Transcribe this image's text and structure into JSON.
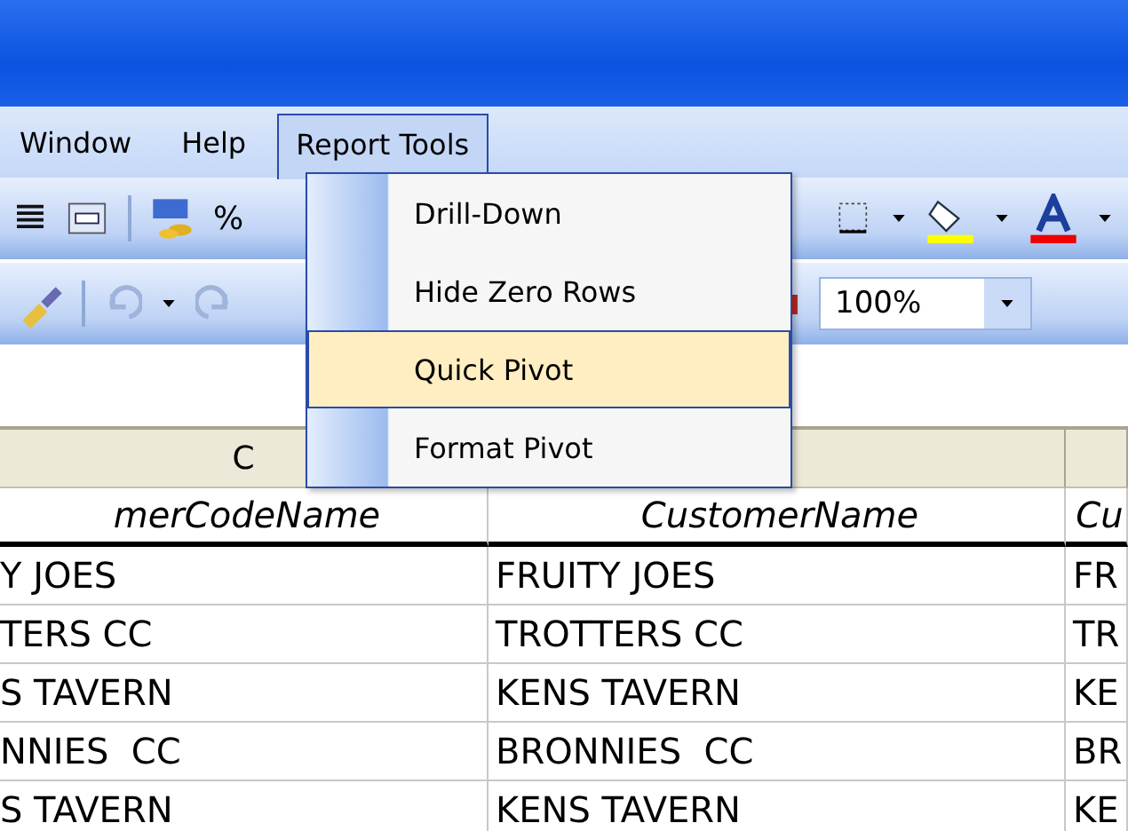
{
  "menu_bar": [
    {
      "label": "Window",
      "selected": false
    },
    {
      "label": "Help",
      "selected": false
    },
    {
      "label": "Report Tools",
      "selected": true
    }
  ],
  "dropdown": [
    {
      "label": "Drill-Down",
      "selected": false
    },
    {
      "label": "Hide Zero Rows",
      "selected": false
    },
    {
      "label": "Quick Pivot",
      "selected": true
    },
    {
      "label": "Format Pivot",
      "selected": false
    }
  ],
  "toolbar": {
    "percent_button": "%",
    "zoom": "100%"
  },
  "sheet": {
    "column_headers": [
      "C"
    ],
    "header_row": [
      "merCodeName",
      "CustomerName",
      "Cu"
    ],
    "rows": [
      [
        "Y JOES",
        "FRUITY JOES",
        "FR"
      ],
      [
        "TERS CC",
        "TROTTERS CC",
        "TR"
      ],
      [
        "S TAVERN",
        "KENS TAVERN",
        "KE"
      ],
      [
        "NNIES  CC",
        "BRONNIES  CC",
        "BR"
      ],
      [
        "S TAVERN",
        "KENS TAVERN",
        "KE"
      ]
    ]
  }
}
